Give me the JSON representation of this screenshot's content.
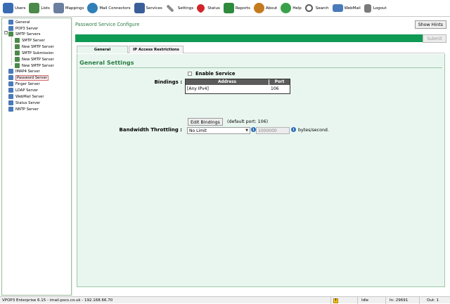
{
  "toolbar": {
    "items": [
      {
        "label": "Users",
        "icon": "users-icon",
        "color": "#3a6cb4"
      },
      {
        "label": "Lists",
        "icon": "lists-icon",
        "color": "#4c8a4a"
      },
      {
        "label": "Mappings",
        "icon": "mappings-icon",
        "color": "#6a7fa0"
      },
      {
        "label": "Mail Connectors",
        "icon": "mail-connectors-icon",
        "color": "#2f7fb8"
      },
      {
        "label": "Services",
        "icon": "services-icon",
        "color": "#3a5e9a"
      },
      {
        "label": "Settings",
        "icon": "settings-icon",
        "color": "#8c8c8c"
      },
      {
        "label": "Status",
        "icon": "status-heart-icon",
        "color": "#d0262a"
      },
      {
        "label": "Reports",
        "icon": "reports-icon",
        "color": "#2e8a3c"
      },
      {
        "label": "About",
        "icon": "about-icon",
        "color": "#c47a1e"
      },
      {
        "label": "Help",
        "icon": "help-icon",
        "color": "#3aa14a"
      },
      {
        "label": "Search",
        "icon": "search-icon",
        "color": "#5b5b5b"
      },
      {
        "label": "WebMail",
        "icon": "webmail-icon",
        "color": "#4a7aba"
      },
      {
        "label": "Logout",
        "icon": "logout-lock-icon",
        "color": "#7a7a7a"
      }
    ]
  },
  "tree": {
    "items": [
      {
        "label": "General"
      },
      {
        "label": "POP3 Server"
      },
      {
        "label": "SMTP Servers"
      },
      {
        "label": "SMTP Server"
      },
      {
        "label": "New SMTP Server"
      },
      {
        "label": "SMTP Submission"
      },
      {
        "label": "New SMTP Server"
      },
      {
        "label": "New SMTP Server"
      },
      {
        "label": "IMAP4 Server"
      },
      {
        "label": "Password Server"
      },
      {
        "label": "Finger Server"
      },
      {
        "label": "LDAP Server"
      },
      {
        "label": "WebMail Server"
      },
      {
        "label": "Status Server"
      },
      {
        "label": "NNTP Server"
      }
    ],
    "expander": "−"
  },
  "main": {
    "title": "Password Service Configure",
    "show_hints": "Show Hints",
    "submit": "Submit",
    "tabs": [
      {
        "label": "General"
      },
      {
        "label": "IP Access Restrictions"
      }
    ],
    "section_title": "General Settings",
    "enable_service": "Enable Service",
    "bindings_label": "Bindings :",
    "bindings_table": {
      "headers": [
        "Address",
        "Port"
      ],
      "rows": [
        [
          "[Any IPv4]",
          "106"
        ]
      ]
    },
    "edit_bindings": "Edit Bindings",
    "default_port": "(default port: 106)",
    "bandwidth_label": "Bandwidth Throttling :",
    "bandwidth_select": "No Limit",
    "bandwidth_value": "1000000",
    "bandwidth_unit": "bytes/second.",
    "info": "i"
  },
  "status": {
    "product": "VPOP3 Enterprise 6.15 - imail.pscs.co.uk - 192.168.66.70",
    "warn": "!",
    "state": "Idle",
    "in": "In: 29691",
    "out": "Out: 1"
  },
  "colors": {
    "accent": "#2c7d43",
    "bar": "#0f9a54",
    "panel": "#e9f6ef"
  }
}
